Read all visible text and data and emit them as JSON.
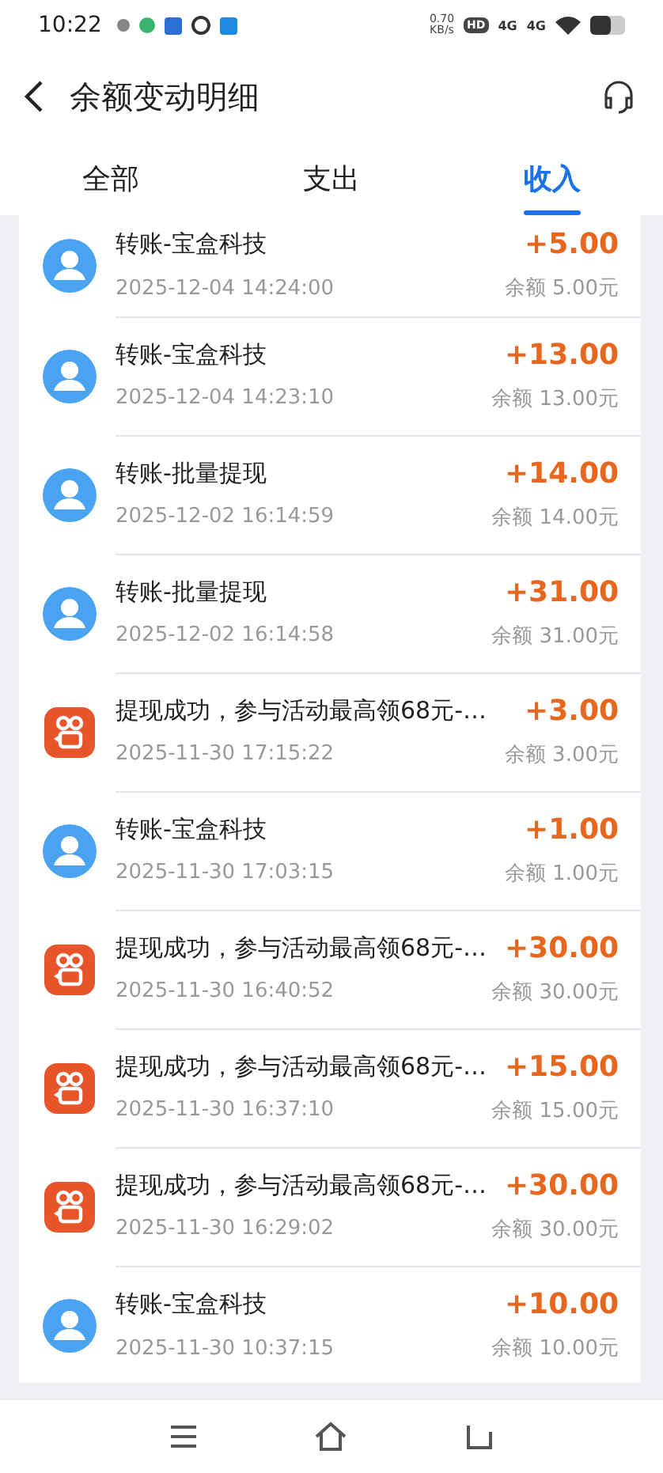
{
  "status_bar": {
    "time": "10:22",
    "speed": "0.70",
    "speed_unit": "KB/s",
    "hd": "HD",
    "network_1": "4G",
    "network_2": "4G"
  },
  "header": {
    "title": "余额变动明细"
  },
  "tabs": [
    {
      "label": "全部",
      "selected": false
    },
    {
      "label": "支出",
      "selected": false
    },
    {
      "label": "收入",
      "selected": true
    }
  ],
  "records": [
    {
      "kind": "person",
      "title": "转账-宝盒科技",
      "time": "2025-12-04 14:24:00",
      "amount": "+5.00",
      "balance": "余额 5.00元"
    },
    {
      "kind": "person",
      "title": "转账-宝盒科技",
      "time": "2025-12-04 14:23:10",
      "amount": "+13.00",
      "balance": "余额 13.00元"
    },
    {
      "kind": "person",
      "title": "转账-批量提现",
      "time": "2025-12-02 16:14:59",
      "amount": "+14.00",
      "balance": "余额 14.00元"
    },
    {
      "kind": "person",
      "title": "转账-批量提现",
      "time": "2025-12-02 16:14:58",
      "amount": "+31.00",
      "balance": "余额 31.00元"
    },
    {
      "kind": "app",
      "title": "提现成功，参与活动最高领68元-…",
      "time": "2025-11-30 17:15:22",
      "amount": "+3.00",
      "balance": "余额 3.00元"
    },
    {
      "kind": "person",
      "title": "转账-宝盒科技",
      "time": "2025-11-30 17:03:15",
      "amount": "+1.00",
      "balance": "余额 1.00元"
    },
    {
      "kind": "app",
      "title": "提现成功，参与活动最高领68元-…",
      "time": "2025-11-30 16:40:52",
      "amount": "+30.00",
      "balance": "余额 30.00元"
    },
    {
      "kind": "app",
      "title": "提现成功，参与活动最高领68元-…",
      "time": "2025-11-30 16:37:10",
      "amount": "+15.00",
      "balance": "余额 15.00元"
    },
    {
      "kind": "app",
      "title": "提现成功，参与活动最高领68元-…",
      "time": "2025-11-30 16:29:02",
      "amount": "+30.00",
      "balance": "余额 30.00元"
    },
    {
      "kind": "person",
      "title": "转账-宝盒科技",
      "time": "2025-11-30 10:37:15",
      "amount": "+10.00",
      "balance": "余额 10.00元"
    }
  ]
}
